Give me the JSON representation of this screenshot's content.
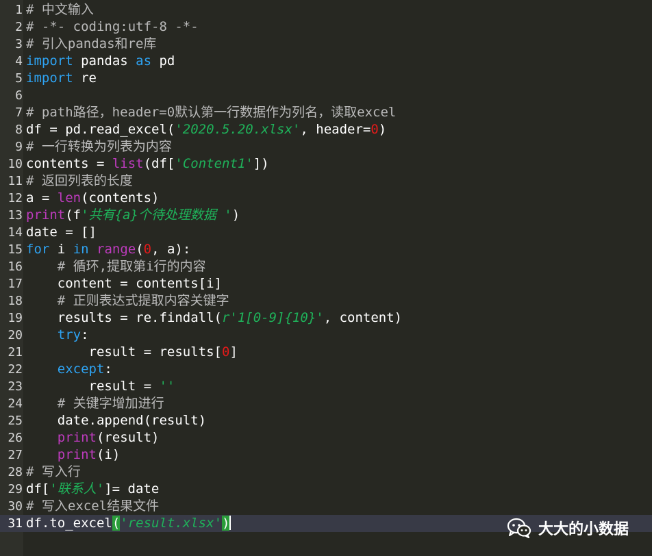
{
  "editor": {
    "current_line": 31,
    "lines": [
      {
        "n": "1",
        "indent": "",
        "tokens": [
          {
            "t": "comment",
            "v": "# 中文输入"
          }
        ]
      },
      {
        "n": "2",
        "indent": "",
        "tokens": [
          {
            "t": "comment",
            "v": "# -*- coding:utf-8 -*-"
          }
        ]
      },
      {
        "n": "3",
        "indent": "",
        "tokens": [
          {
            "t": "comment",
            "v": "# 引入pandas和re库"
          }
        ]
      },
      {
        "n": "4",
        "indent": "",
        "tokens": [
          {
            "t": "kw",
            "v": "import"
          },
          {
            "t": "plain",
            "v": " pandas "
          },
          {
            "t": "kw",
            "v": "as"
          },
          {
            "t": "plain",
            "v": " pd"
          }
        ]
      },
      {
        "n": "5",
        "indent": "",
        "tokens": [
          {
            "t": "kw",
            "v": "import"
          },
          {
            "t": "plain",
            "v": " re"
          }
        ]
      },
      {
        "n": "6",
        "indent": "",
        "tokens": []
      },
      {
        "n": "7",
        "indent": "",
        "tokens": [
          {
            "t": "comment",
            "v": "# path路径，header=0默认第一行数据作为列名，读取excel"
          }
        ]
      },
      {
        "n": "8",
        "indent": "",
        "tokens": [
          {
            "t": "plain",
            "v": "df = pd.read_excel("
          },
          {
            "t": "str",
            "v": "'2020.5.20.xlsx'"
          },
          {
            "t": "plain",
            "v": ", header="
          },
          {
            "t": "num",
            "v": "0"
          },
          {
            "t": "plain",
            "v": ")"
          }
        ]
      },
      {
        "n": "9",
        "indent": "",
        "tokens": [
          {
            "t": "comment",
            "v": "# 一行转换为列表为内容"
          }
        ]
      },
      {
        "n": "10",
        "indent": "",
        "tokens": [
          {
            "t": "plain",
            "v": "contents = "
          },
          {
            "t": "builtin",
            "v": "list"
          },
          {
            "t": "plain",
            "v": "(df["
          },
          {
            "t": "str",
            "v": "'Content1'"
          },
          {
            "t": "plain",
            "v": "])"
          }
        ]
      },
      {
        "n": "11",
        "indent": "",
        "tokens": [
          {
            "t": "comment",
            "v": "# 返回列表的长度"
          }
        ]
      },
      {
        "n": "12",
        "indent": "",
        "tokens": [
          {
            "t": "plain",
            "v": "a = "
          },
          {
            "t": "builtin",
            "v": "len"
          },
          {
            "t": "plain",
            "v": "(contents)"
          }
        ]
      },
      {
        "n": "13",
        "indent": "",
        "tokens": [
          {
            "t": "builtin",
            "v": "print"
          },
          {
            "t": "plain",
            "v": "(f"
          },
          {
            "t": "str",
            "v": "'共有{a}个待处理数据 '"
          },
          {
            "t": "plain",
            "v": ")"
          }
        ]
      },
      {
        "n": "14",
        "indent": "",
        "tokens": [
          {
            "t": "plain",
            "v": "date = []"
          }
        ]
      },
      {
        "n": "15",
        "indent": "",
        "tokens": [
          {
            "t": "kw",
            "v": "for"
          },
          {
            "t": "plain",
            "v": " i "
          },
          {
            "t": "kw",
            "v": "in"
          },
          {
            "t": "plain",
            "v": " "
          },
          {
            "t": "builtin",
            "v": "range"
          },
          {
            "t": "plain",
            "v": "("
          },
          {
            "t": "num",
            "v": "0"
          },
          {
            "t": "plain",
            "v": ", a):"
          }
        ]
      },
      {
        "n": "16",
        "indent": "    ",
        "tokens": [
          {
            "t": "comment",
            "v": "# 循环,提取第i行的内容"
          }
        ]
      },
      {
        "n": "17",
        "indent": "    ",
        "tokens": [
          {
            "t": "plain",
            "v": "content = contents[i]"
          }
        ]
      },
      {
        "n": "18",
        "indent": "    ",
        "tokens": [
          {
            "t": "comment",
            "v": "# 正则表达式提取内容关键字"
          }
        ]
      },
      {
        "n": "19",
        "indent": "    ",
        "tokens": [
          {
            "t": "plain",
            "v": "results = re.findall("
          },
          {
            "t": "str",
            "v": "r'1[0-9]{10}'"
          },
          {
            "t": "plain",
            "v": ", content)"
          }
        ]
      },
      {
        "n": "20",
        "indent": "    ",
        "tokens": [
          {
            "t": "kw",
            "v": "try"
          },
          {
            "t": "plain",
            "v": ":"
          }
        ]
      },
      {
        "n": "21",
        "indent": "        ",
        "tokens": [
          {
            "t": "plain",
            "v": "result = results["
          },
          {
            "t": "num",
            "v": "0"
          },
          {
            "t": "plain",
            "v": "]"
          }
        ]
      },
      {
        "n": "22",
        "indent": "    ",
        "tokens": [
          {
            "t": "kw",
            "v": "except"
          },
          {
            "t": "plain",
            "v": ":"
          }
        ]
      },
      {
        "n": "23",
        "indent": "        ",
        "tokens": [
          {
            "t": "plain",
            "v": "result = "
          },
          {
            "t": "str",
            "v": "''"
          }
        ]
      },
      {
        "n": "24",
        "indent": "    ",
        "tokens": [
          {
            "t": "comment",
            "v": "# 关键字增加进行"
          }
        ]
      },
      {
        "n": "25",
        "indent": "    ",
        "tokens": [
          {
            "t": "plain",
            "v": "date.append(result)"
          }
        ]
      },
      {
        "n": "26",
        "indent": "    ",
        "tokens": [
          {
            "t": "builtin",
            "v": "print"
          },
          {
            "t": "plain",
            "v": "(result)"
          }
        ]
      },
      {
        "n": "27",
        "indent": "    ",
        "tokens": [
          {
            "t": "builtin",
            "v": "print"
          },
          {
            "t": "plain",
            "v": "(i)"
          }
        ]
      },
      {
        "n": "28",
        "indent": "",
        "tokens": [
          {
            "t": "comment",
            "v": "# 写入行"
          }
        ]
      },
      {
        "n": "29",
        "indent": "",
        "tokens": [
          {
            "t": "plain",
            "v": "df["
          },
          {
            "t": "str",
            "v": "'联系人'"
          },
          {
            "t": "plain",
            "v": "]= date"
          }
        ]
      },
      {
        "n": "30",
        "indent": "",
        "tokens": [
          {
            "t": "comment",
            "v": "# 写入excel结果文件"
          }
        ]
      },
      {
        "n": "31",
        "indent": "",
        "tokens": [
          {
            "t": "plain",
            "v": "df.to_excel"
          },
          {
            "t": "bracket-hl",
            "v": "("
          },
          {
            "t": "str",
            "v": "'result.xlsx'"
          },
          {
            "t": "bracket-hl",
            "v": ")"
          }
        ]
      }
    ]
  },
  "watermark": {
    "text": "大大的小数据",
    "icon": "wechat-icon"
  },
  "colors": {
    "background": "#272822",
    "keyword": "#2ea3f2",
    "builtin": "#bd3bbd",
    "string": "#1fb25a",
    "number": "#e11a1a",
    "comment": "#b9b9b9",
    "current_line": "#383a46",
    "bracket_highlight": "#2a9d3a"
  }
}
